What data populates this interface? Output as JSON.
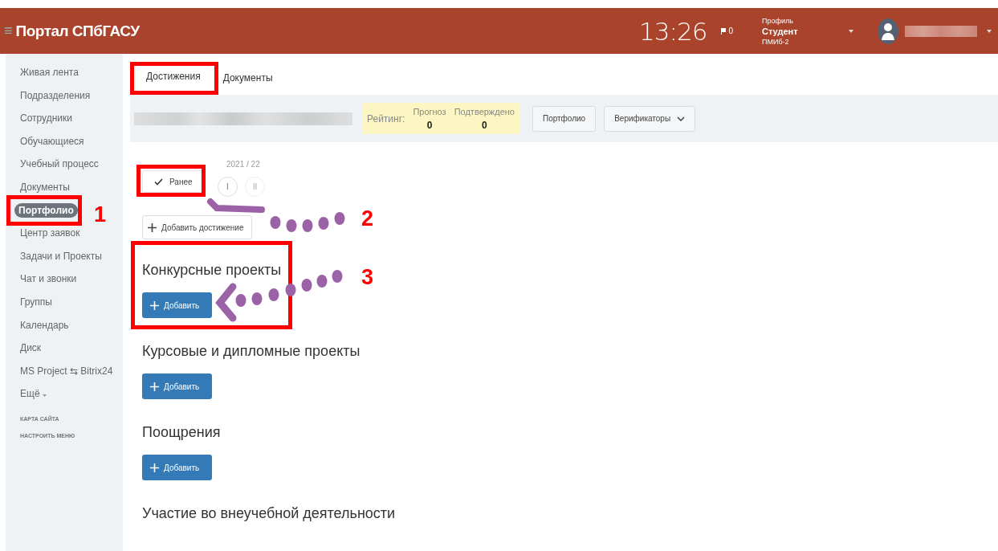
{
  "header": {
    "menu_glyph": "≡",
    "title": "Портал СПбГАСУ",
    "time": "13:26",
    "notifications": "0",
    "profile": {
      "label": "Профиль",
      "role": "Студент",
      "group": "ПМИб-2"
    }
  },
  "sidebar": {
    "items": [
      {
        "label": "Живая лента",
        "selected": false,
        "kind": "link"
      },
      {
        "label": "Подразделения",
        "selected": false,
        "kind": "link"
      },
      {
        "label": "Сотрудники",
        "selected": false,
        "kind": "link"
      },
      {
        "label": "Обучающиеся",
        "selected": false,
        "kind": "link"
      },
      {
        "label": "Учебный процесс",
        "selected": false,
        "kind": "link"
      },
      {
        "label": "Документы",
        "selected": false,
        "kind": "link"
      },
      {
        "label": "Портфолио",
        "selected": true,
        "kind": "link"
      },
      {
        "label": "Центр заявок",
        "selected": false,
        "kind": "link"
      },
      {
        "label": "Задачи и Проекты",
        "selected": false,
        "kind": "link"
      },
      {
        "label": "Чат и звонки",
        "selected": false,
        "kind": "link"
      },
      {
        "label": "Группы",
        "selected": false,
        "kind": "link"
      },
      {
        "label": "Календарь",
        "selected": false,
        "kind": "link"
      },
      {
        "label": "Диск",
        "selected": false,
        "kind": "link"
      },
      {
        "label": "MS Project ⇆ Bitrix24",
        "selected": false,
        "kind": "link"
      },
      {
        "label": "Ещё",
        "selected": false,
        "kind": "more"
      }
    ],
    "links": [
      "КАРТА САЙТА",
      "НАСТРОИТЬ МЕНЮ"
    ]
  },
  "tabs": [
    {
      "label": "Достижения",
      "selected": true
    },
    {
      "label": "Документы",
      "selected": false
    }
  ],
  "summary": {
    "rating_label": "Рейтинг:",
    "columns": [
      {
        "label": "Прогноз",
        "value": "0"
      },
      {
        "label": "Подтверждено",
        "value": "0"
      }
    ],
    "buttons": [
      {
        "label": "Портфолио",
        "kind": "plain"
      },
      {
        "label": "Верификаторы",
        "kind": "dropdown"
      }
    ]
  },
  "period": {
    "year": "2021 / 22",
    "previous": {
      "label": "Ранее",
      "checked": true
    },
    "terms": [
      {
        "label": "I",
        "disabled": false
      },
      {
        "label": "II",
        "disabled": true
      }
    ]
  },
  "add_achievement": "Добавить достижение",
  "sections": [
    {
      "title": "Конкурсные проекты",
      "button": "Добавить"
    },
    {
      "title": "Курсовые и дипломные проекты",
      "button": "Добавить"
    },
    {
      "title": "Поощрения",
      "button": "Добавить"
    },
    {
      "title": "Участие во внеучебной деятельности"
    }
  ],
  "annotations": [
    {
      "number": "1"
    },
    {
      "number": "2"
    },
    {
      "number": "3"
    }
  ]
}
